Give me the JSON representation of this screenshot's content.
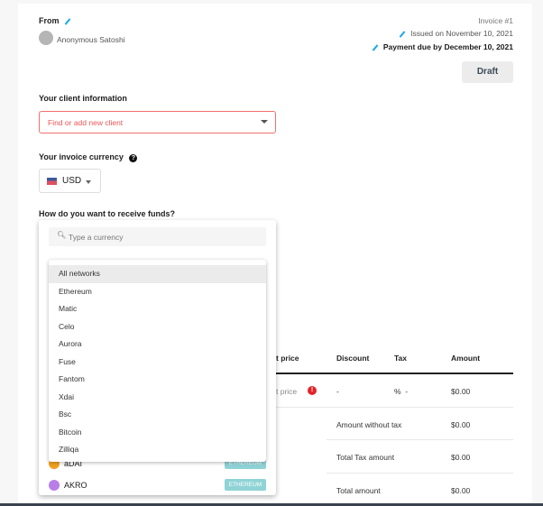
{
  "header": {
    "from_label": "From",
    "sender_name": "Anonymous Satoshi",
    "invoice_number": "Invoice #1",
    "issued": "Issued on November 10, 2021",
    "due": "Payment due by December 10, 2021",
    "status_button": "Draft"
  },
  "client": {
    "label": "Your client information",
    "placeholder": "Find or add new client"
  },
  "currency": {
    "label": "Your invoice currency",
    "value": "USD"
  },
  "funds": {
    "label": "How do you want to receive funds?",
    "search_placeholder": "Type a currency",
    "networks": [
      "All networks",
      "Ethereum",
      "Matic",
      "Celo",
      "Aurora",
      "Fuse",
      "Fantom",
      "Xdai",
      "Bsc",
      "Bitcoin",
      "Zilliqa"
    ],
    "selected_network": "All networks",
    "currencies": [
      {
        "symbol": "aDAI",
        "network": "ETHEREUM"
      },
      {
        "symbol": "AKRO",
        "network": "ETHEREUM"
      }
    ]
  },
  "table": {
    "headers": {
      "unit_price": "t price",
      "discount": "Discount",
      "tax": "Tax",
      "amount": "Amount"
    },
    "row": {
      "unit_price": "t price",
      "discount": "-",
      "tax": "%  -",
      "amount": "$0.00"
    },
    "totals": [
      {
        "label": "Amount without tax",
        "value": "$0.00"
      },
      {
        "label": "Total Tax amount",
        "value": "$0.00"
      },
      {
        "label": "Total amount",
        "value": "$0.00"
      }
    ]
  },
  "colors": {
    "accent": "#1fa8e8",
    "error": "#e5484d",
    "badge": "#8fd3d6"
  }
}
